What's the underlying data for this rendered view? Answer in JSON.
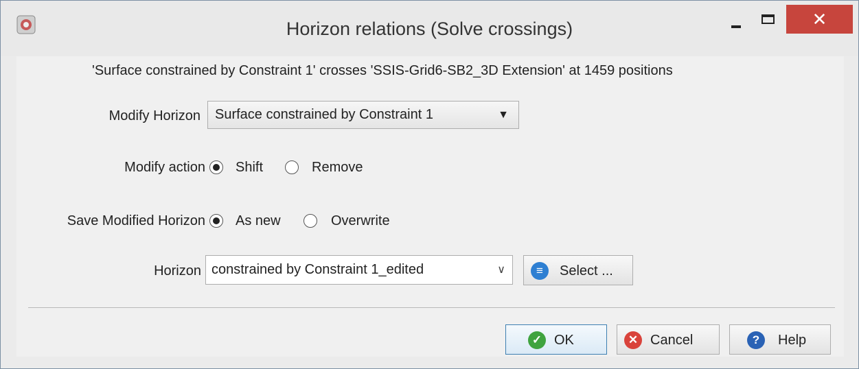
{
  "window": {
    "title": "Horizon relations (Solve crossings)",
    "close_glyph": "✕"
  },
  "message": "'Surface constrained by Constraint 1' crosses 'SSIS-Grid6-SB2_3D Extension' at 1459 positions",
  "modify_horizon": {
    "label": "Modify Horizon",
    "value": "Surface constrained by Constraint 1"
  },
  "modify_action": {
    "label": "Modify action",
    "options": [
      "Shift",
      "Remove"
    ],
    "selected": "Shift"
  },
  "save_modified": {
    "label": "Save Modified Horizon",
    "options": [
      "As new",
      "Overwrite"
    ],
    "selected": "As new"
  },
  "horizon": {
    "label": "Horizon",
    "value": "constrained by Constraint 1_edited",
    "select_label": "Select ..."
  },
  "buttons": {
    "ok": "OK",
    "cancel": "Cancel",
    "help": "Help"
  },
  "icons": {
    "app": "app-icon",
    "select": "list-icon",
    "ok": "check-icon",
    "cancel": "x-circle-icon",
    "help": "question-icon"
  },
  "colors": {
    "close": "#c7453d",
    "ok_icon": "#3fa33f",
    "cancel_icon": "#d9433b",
    "help_icon": "#2a62b5",
    "select_icon": "#2e7fd2"
  }
}
